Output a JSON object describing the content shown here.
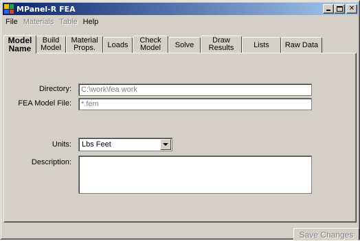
{
  "window": {
    "title": "MPanel-R FEA"
  },
  "menu": [
    {
      "label": "File",
      "enabled": true
    },
    {
      "label": "Materials",
      "enabled": false
    },
    {
      "label": "Table",
      "enabled": false
    },
    {
      "label": "Help",
      "enabled": true
    }
  ],
  "tabs": [
    {
      "label": "Model\nName",
      "active": true
    },
    {
      "label": "Build\nModel",
      "active": false
    },
    {
      "label": "Material\nProps.",
      "active": false
    },
    {
      "label": "Loads",
      "active": false
    },
    {
      "label": "Check\nModel",
      "active": false
    },
    {
      "label": "Solve",
      "active": false
    },
    {
      "label": "Draw\nResults",
      "active": false
    },
    {
      "label": "Lists",
      "active": false
    },
    {
      "label": "Raw Data",
      "active": false
    }
  ],
  "form": {
    "directory_label": "Directory:",
    "directory_value": "C:\\work\\fea work",
    "model_file_label": "FEA Model File:",
    "model_file_value": "*.fem",
    "units_label": "Units:",
    "units_value": "Lbs Feet",
    "description_label": "Description:",
    "description_value": ""
  },
  "footer": {
    "save_label": "Save Changes",
    "save_enabled": false
  },
  "colors": {
    "face": "#d4d0c8",
    "title_start": "#0a246a",
    "title_end": "#a6caf0",
    "disabled_text": "#808080"
  }
}
